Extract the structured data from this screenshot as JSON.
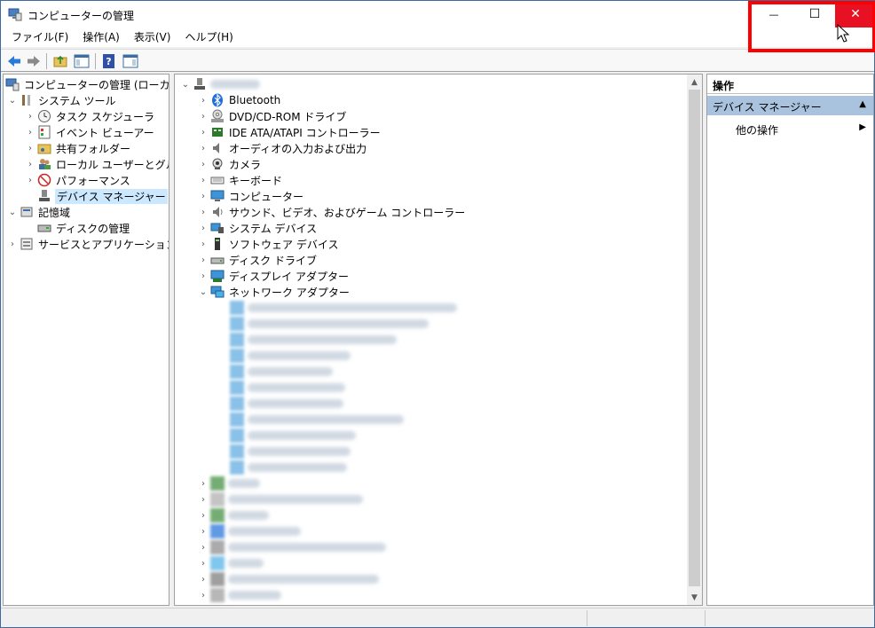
{
  "window": {
    "title": "コンピューターの管理",
    "controls": {
      "minimize": "—",
      "maximize": "☐",
      "close": "✕"
    }
  },
  "menu": [
    "ファイル(F)",
    "操作(A)",
    "表示(V)",
    "ヘルプ(H)"
  ],
  "left_tree": [
    {
      "label": "コンピューターの管理 (ローカル)",
      "indent": 0,
      "chev": "",
      "icon": "computer-management-icon"
    },
    {
      "label": "システム ツール",
      "indent": 1,
      "chev": "v",
      "icon": "tools-icon"
    },
    {
      "label": "タスク スケジューラ",
      "indent": 2,
      "chev": ">",
      "icon": "clock-icon"
    },
    {
      "label": "イベント ビューアー",
      "indent": 2,
      "chev": ">",
      "icon": "event-viewer-icon"
    },
    {
      "label": "共有フォルダー",
      "indent": 2,
      "chev": ">",
      "icon": "shared-folder-icon"
    },
    {
      "label": "ローカル ユーザーとグループ",
      "indent": 2,
      "chev": ">",
      "icon": "users-icon"
    },
    {
      "label": "パフォーマンス",
      "indent": 2,
      "chev": ">",
      "icon": "performance-icon"
    },
    {
      "label": "デバイス マネージャー",
      "indent": 2,
      "chev": "",
      "icon": "device-manager-icon",
      "selected": true
    },
    {
      "label": "記憶域",
      "indent": 1,
      "chev": "v",
      "icon": "storage-icon"
    },
    {
      "label": "ディスクの管理",
      "indent": 2,
      "chev": "",
      "icon": "disk-icon"
    },
    {
      "label": "サービスとアプリケーション",
      "indent": 1,
      "chev": ">",
      "icon": "services-icon"
    }
  ],
  "device_tree": [
    {
      "label": "Bluetooth",
      "icon": "bluetooth-icon"
    },
    {
      "label": "DVD/CD-ROM ドライブ",
      "icon": "dvd-icon"
    },
    {
      "label": "IDE ATA/ATAPI コントローラー",
      "icon": "ide-icon"
    },
    {
      "label": "オーディオの入力および出力",
      "icon": "audio-icon"
    },
    {
      "label": "カメラ",
      "icon": "camera-icon"
    },
    {
      "label": "キーボード",
      "icon": "keyboard-icon"
    },
    {
      "label": "コンピューター",
      "icon": "monitor-icon"
    },
    {
      "label": "サウンド、ビデオ、およびゲーム コントローラー",
      "icon": "sound-icon"
    },
    {
      "label": "システム デバイス",
      "icon": "system-device-icon"
    },
    {
      "label": "ソフトウェア デバイス",
      "icon": "software-device-icon"
    },
    {
      "label": "ディスク ドライブ",
      "icon": "disk-drive-icon"
    },
    {
      "label": "ディスプレイ アダプター",
      "icon": "display-adapter-icon"
    },
    {
      "label": "ネットワーク アダプター",
      "icon": "network-adapter-icon",
      "expanded": true
    }
  ],
  "actions": {
    "header": "操作",
    "section": "デバイス マネージャー",
    "item": "他の操作"
  }
}
